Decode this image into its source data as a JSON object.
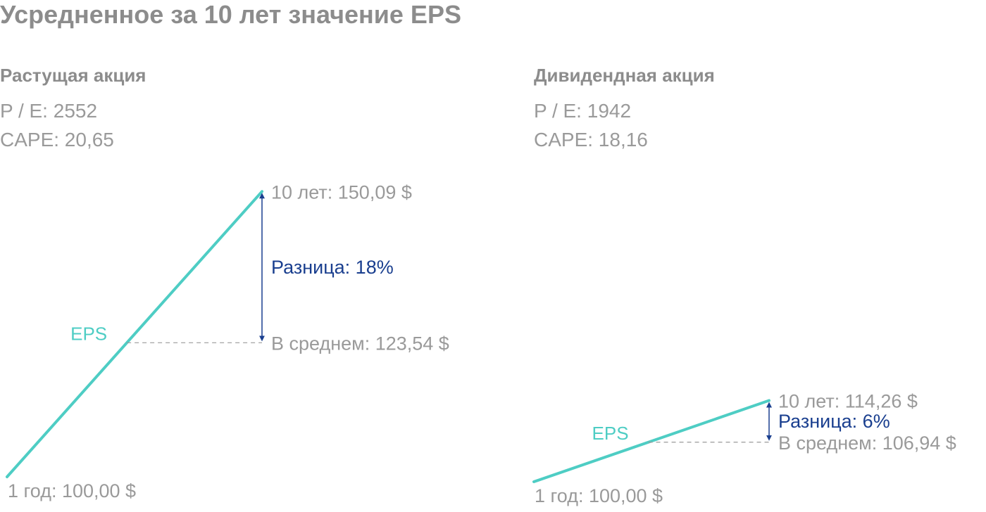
{
  "title": "Усредненное за 10 лет значение EPS",
  "colors": {
    "line": "#4ecdc4",
    "arrow": "#1a3f8f",
    "diff_text": "#1a3f8f",
    "label_text": "#9a9a9a",
    "dashed": "#9a9a9a",
    "title_text": "#8c8c8c"
  },
  "panels": [
    {
      "title": "Растущая акция",
      "pe_text": "P / E: 2552",
      "cape_text": "CAPE: 20,65"
    },
    {
      "title": "Дивидендная акция",
      "pe_text": "P / E: 1942",
      "cape_text": "CAPE: 18,16"
    }
  ],
  "chart_data": [
    {
      "type": "line",
      "series_label": "EPS",
      "start": {
        "label": "1 год: 100,00 $",
        "value": 100.0
      },
      "end": {
        "label": "10 лет: 150,09 $",
        "value": 150.09
      },
      "average": {
        "label": "В среднем: 123,54 $",
        "value": 123.54
      },
      "difference": {
        "label": "Разница: 18%",
        "percent": 18
      }
    },
    {
      "type": "line",
      "series_label": "EPS",
      "start": {
        "label": "1 год: 100,00 $",
        "value": 100.0
      },
      "end": {
        "label": "10 лет: 114,26 $",
        "value": 114.26
      },
      "average": {
        "label": "В среднем: 106,94 $",
        "value": 106.94
      },
      "difference": {
        "label": "Разница: 6%",
        "percent": 6
      }
    }
  ]
}
